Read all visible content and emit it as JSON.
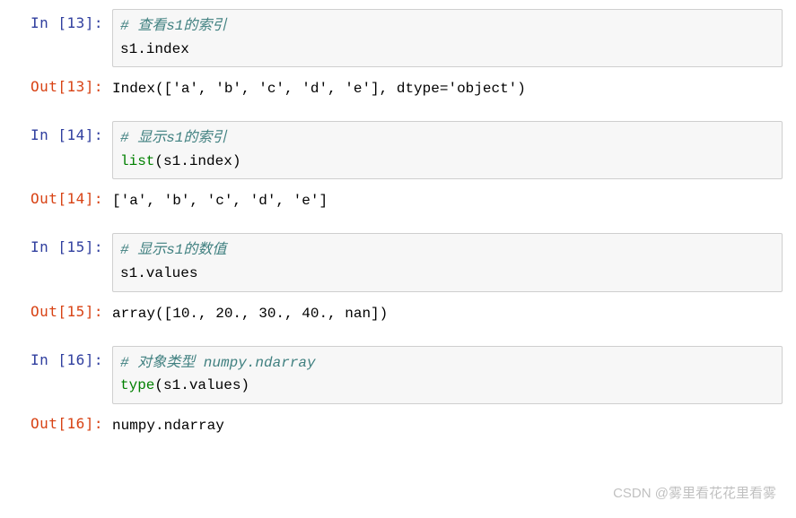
{
  "cells": [
    {
      "in_prompt": "In  [13]:",
      "out_prompt": "Out[13]:",
      "code_comment": "# 查看s1的索引",
      "code_line2_pre": "s1",
      "code_line2_post": ".index",
      "output": "Index(['a', 'b', 'c', 'd', 'e'], dtype='object')"
    },
    {
      "in_prompt": "In  [14]:",
      "out_prompt": "Out[14]:",
      "code_comment": "# 显示s1的索引",
      "builtin": "list",
      "args_pre": "(s1",
      "args_post": ".index)",
      "output": "['a', 'b', 'c', 'd', 'e']"
    },
    {
      "in_prompt": "In  [15]:",
      "out_prompt": "Out[15]:",
      "code_comment": "# 显示s1的数值",
      "code_line2_pre": "s1",
      "code_line2_post": ".values",
      "output": "array([10., 20., 30., 40., nan])"
    },
    {
      "in_prompt": "In  [16]:",
      "out_prompt": "Out[16]:",
      "code_comment": "# 对象类型 numpy.ndarray",
      "builtin": "type",
      "args_pre": "(s1",
      "args_post": ".values)",
      "output": "numpy.ndarray"
    }
  ],
  "watermark": "CSDN @雾里看花花里看雾"
}
